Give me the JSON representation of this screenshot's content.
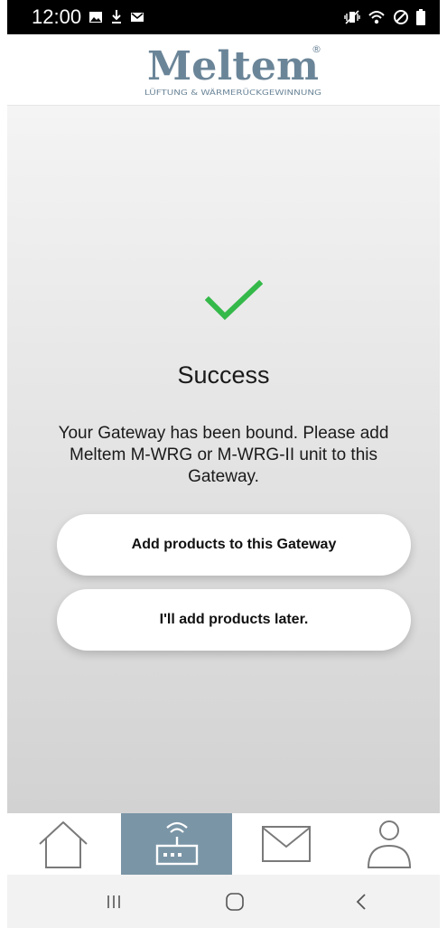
{
  "status_bar": {
    "time": "12:00",
    "left_icons": [
      "image-icon",
      "download-icon",
      "mail-icon"
    ],
    "right_icons": [
      "vibrate-icon",
      "wifi-icon",
      "do-not-disturb-icon",
      "battery-icon"
    ]
  },
  "header": {
    "logo_text": "Meltem",
    "logo_tagline": "LÜFTUNG & WÄRMERÜCKGEWINNUNG",
    "logo_mark": "®"
  },
  "main": {
    "success_icon": "checkmark-icon",
    "title": "Success",
    "message": "Your Gateway has been bound. Please add Meltem M-WRG or M-WRG-II unit to this Gateway.",
    "primary_button_label": "Add products to this Gateway",
    "secondary_button_label": "I'll add products later."
  },
  "tab_bar": {
    "active_tab": "gateway",
    "tabs": [
      {
        "id": "home",
        "icon": "house-icon"
      },
      {
        "id": "gateway",
        "icon": "router-icon"
      },
      {
        "id": "messages",
        "icon": "envelope-icon"
      },
      {
        "id": "profile",
        "icon": "person-icon"
      }
    ]
  },
  "system_nav": {
    "buttons": [
      "recent-apps-icon",
      "home-icon",
      "back-icon"
    ]
  },
  "colors": {
    "brand": "#6b8598",
    "accent_green": "#35b94a",
    "active_tab": "#7a95a6",
    "tab_icon": "#7a7a7a"
  }
}
